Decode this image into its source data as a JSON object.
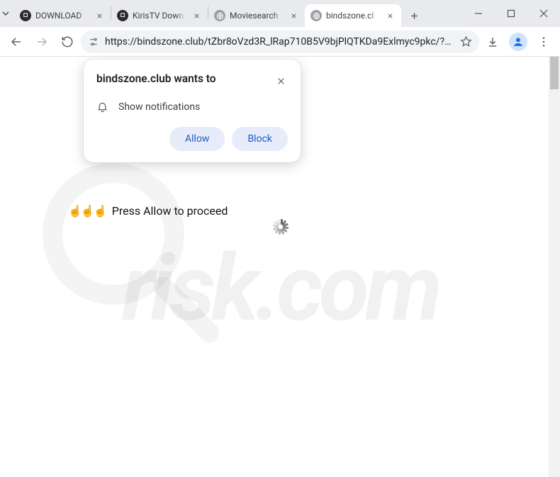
{
  "tabs": [
    {
      "title": "DOWNLOAD",
      "favicon": "dark"
    },
    {
      "title": "KirisTV Down",
      "favicon": "dark"
    },
    {
      "title": "Moviesearch",
      "favicon": "globe"
    },
    {
      "title": "bindszone.cl",
      "favicon": "globe",
      "active": true
    }
  ],
  "omnibox": {
    "url": "https://bindszone.club/tZbr8oVzd3R_lRap710B5V9bjPlQTKDa9Exlmyc9pkc/?cid…"
  },
  "permission": {
    "title": "bindszone.club wants to",
    "item": "Show notifications",
    "allow": "Allow",
    "block": "Block"
  },
  "page": {
    "prompt": "Press Allow to proceed"
  },
  "watermark": {
    "text": "risk.com"
  }
}
